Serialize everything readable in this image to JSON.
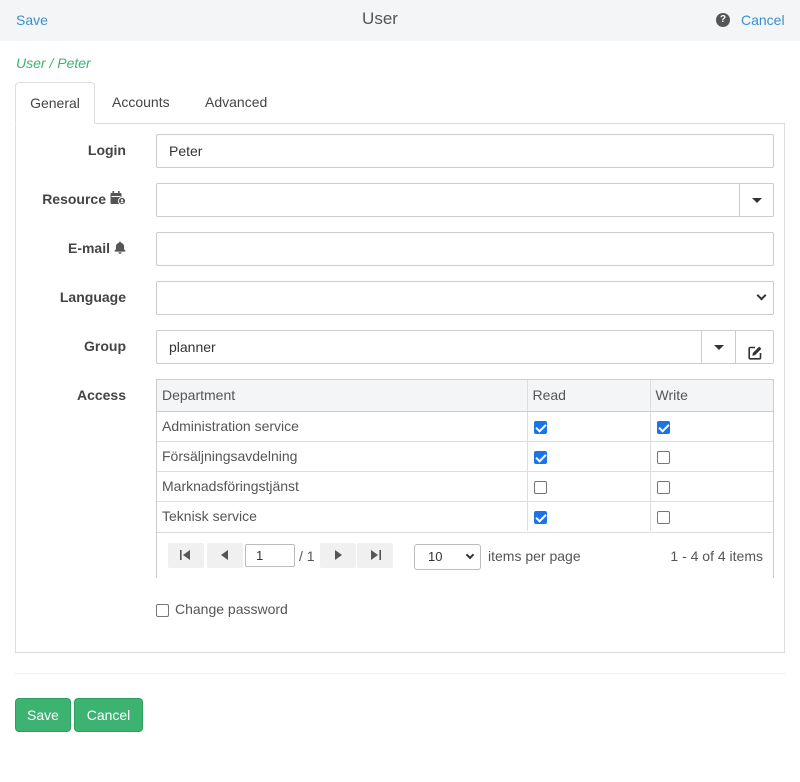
{
  "header": {
    "save_label": "Save",
    "title": "User",
    "help_glyph": "?",
    "cancel_label": "Cancel"
  },
  "breadcrumb": "User / Peter",
  "tabs": [
    {
      "label": "General",
      "active": true
    },
    {
      "label": "Accounts",
      "active": false
    },
    {
      "label": "Advanced",
      "active": false
    }
  ],
  "form": {
    "login": {
      "label": "Login",
      "value": "Peter"
    },
    "resource": {
      "label": "Resource",
      "icon": "calendar-user-icon",
      "value": ""
    },
    "email": {
      "label": "E-mail",
      "icon": "bell-icon",
      "value": ""
    },
    "language": {
      "label": "Language",
      "value": ""
    },
    "group": {
      "label": "Group",
      "value": "planner"
    },
    "access": {
      "label": "Access"
    }
  },
  "access_grid": {
    "columns": [
      "Department",
      "Read",
      "Write"
    ],
    "rows": [
      {
        "department": "Administration service",
        "read": true,
        "write": true
      },
      {
        "department": "Försäljningsavdelning",
        "read": true,
        "write": false
      },
      {
        "department": "Marknadsföringstjänst",
        "read": false,
        "write": false
      },
      {
        "department": "Teknisk service",
        "read": true,
        "write": false
      }
    ],
    "pager": {
      "page": "1",
      "of": "/ 1",
      "page_size": "10",
      "items_label": "items per page",
      "info": "1 - 4 of 4 items"
    }
  },
  "change_password_label": "Change password",
  "footer": {
    "save_label": "Save",
    "cancel_label": "Cancel"
  },
  "colors": {
    "accent": "#3cb371",
    "link": "#3a8fd0",
    "checkbox": "#1a73e8"
  }
}
